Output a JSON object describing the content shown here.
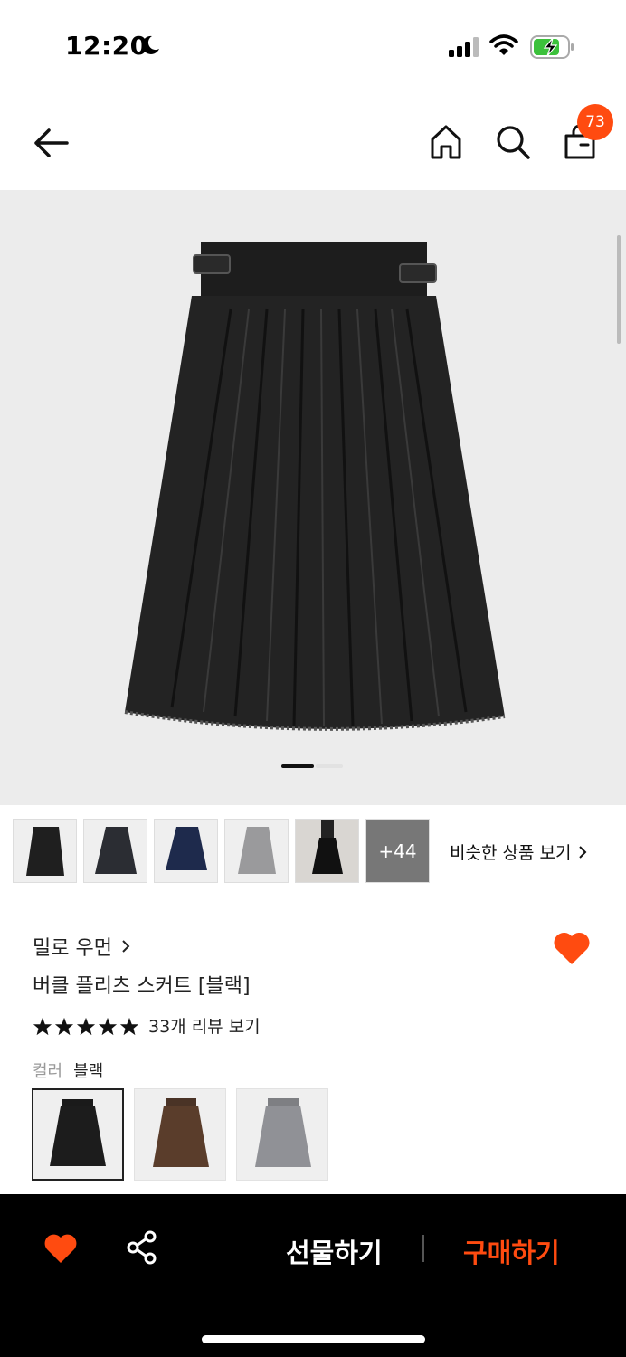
{
  "status_bar": {
    "time": "12:20"
  },
  "header": {
    "cart_count": "73"
  },
  "gallery": {
    "more_count": "+44",
    "similar_label": "비슷한 상품 보기"
  },
  "product": {
    "brand": "밀로 우먼",
    "name": "버클 플리츠 스커트 [블랙]",
    "rating_stars": 5,
    "review_link": "33개 리뷰 보기",
    "color_label": "컬러",
    "color_value": "블랙",
    "color_options": [
      "black",
      "brown",
      "gray"
    ]
  },
  "bottom_bar": {
    "gift_label": "선물하기",
    "buy_label": "구매하기"
  },
  "colors": {
    "accent": "#ff4b10",
    "bottom_bg": "#000000",
    "gallery_bg": "#ececec"
  }
}
